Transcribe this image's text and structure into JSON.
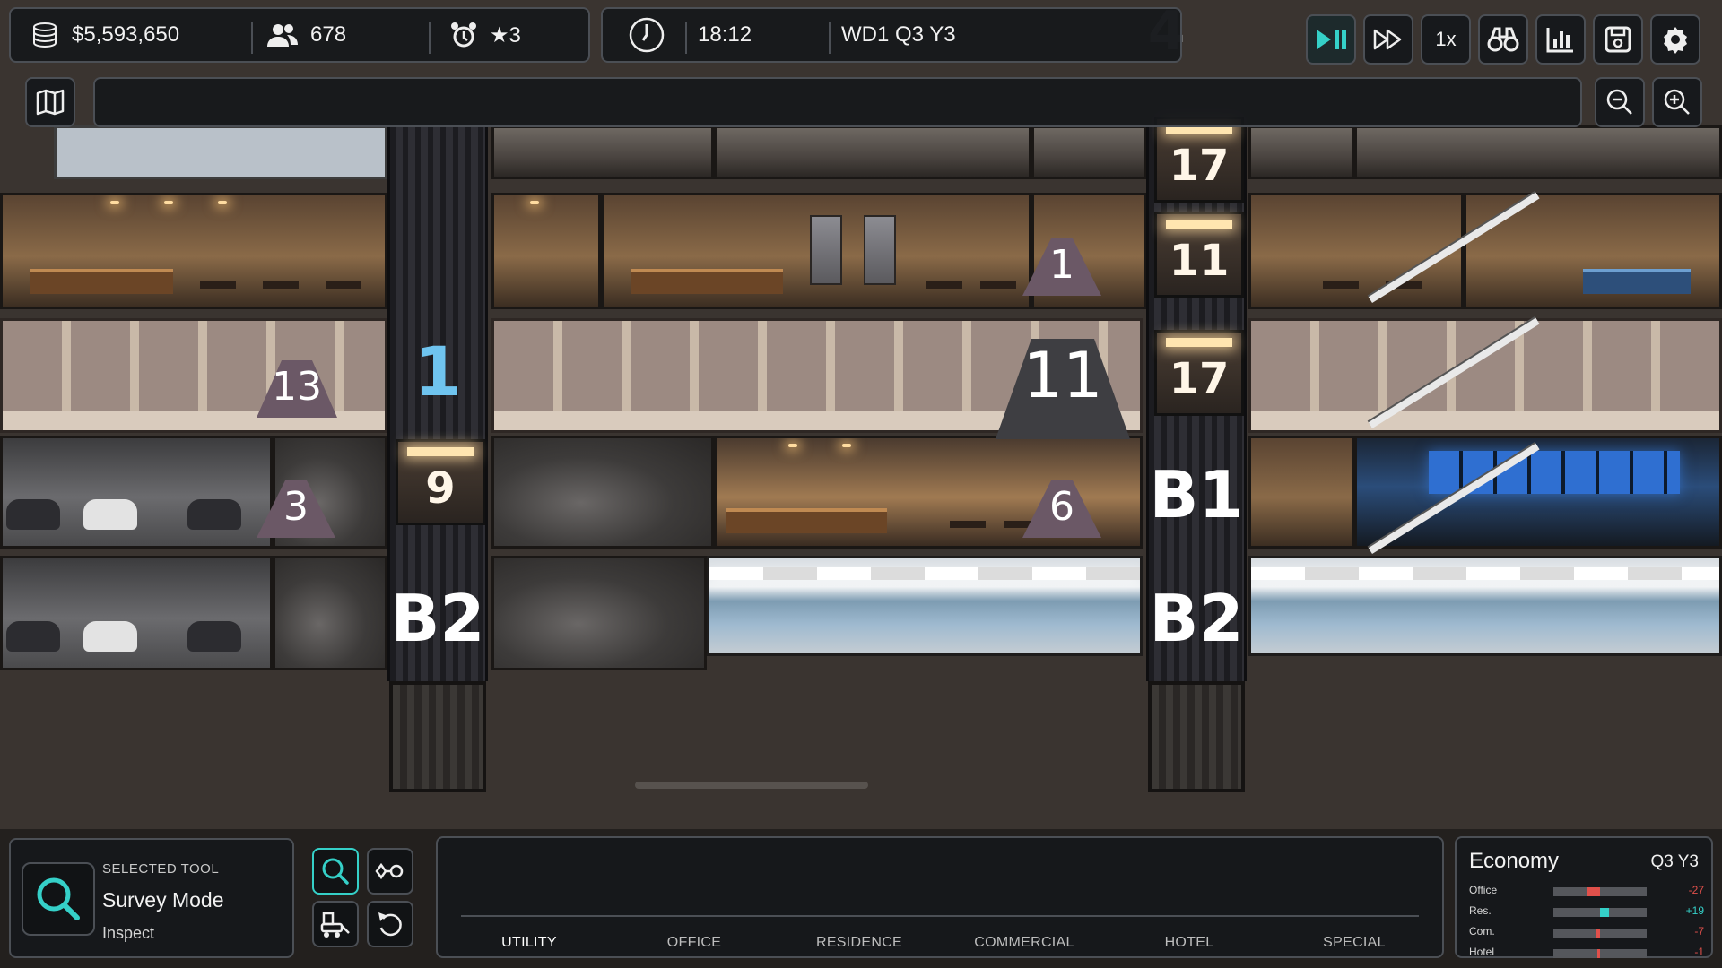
{
  "hud": {
    "money": "$5,593,650",
    "population": "678",
    "rating": "★3",
    "time": "18:12",
    "date": "WD1 Q3 Y3",
    "speed_label": "1x",
    "search_placeholder": ""
  },
  "scene": {
    "shafts": [
      {
        "labels": [
          "1",
          "B2"
        ],
        "cabs": [
          "9"
        ]
      },
      {
        "labels": [
          "B1",
          "B2"
        ],
        "cabs": [
          "17",
          "11",
          "17"
        ]
      }
    ],
    "queues": [
      "13",
      "3",
      "1",
      "11",
      "6"
    ],
    "background_floor_label": "4"
  },
  "tool": {
    "caption": "SELECTED TOOL",
    "name": "Survey Mode",
    "sub": "Inspect"
  },
  "build": {
    "tabs": [
      "UTILITY",
      "OFFICE",
      "RESIDENCE",
      "COMMERCIAL",
      "HOTEL",
      "SPECIAL"
    ],
    "active_tab": "UTILITY"
  },
  "economy": {
    "title": "Economy",
    "period": "Q3 Y3",
    "rows": [
      {
        "label": "Office",
        "value": "-27",
        "level": -0.27
      },
      {
        "label": "Res.",
        "value": "+19",
        "level": 0.19
      },
      {
        "label": "Com.",
        "value": "-7",
        "level": -0.07
      },
      {
        "label": "Hotel",
        "value": "-1",
        "level": -0.01
      }
    ]
  },
  "colors": {
    "accent": "#35d0c8",
    "positive": "#35d0c8",
    "negative": "#e0504b",
    "queue": "#6b5866"
  },
  "icons": [
    "coins-icon",
    "people-icon",
    "alarm-icon",
    "clock-icon",
    "play-pause-icon",
    "fast-forward-icon",
    "binoculars-icon",
    "chart-icon",
    "save-icon",
    "gear-icon",
    "map-icon",
    "zoom-out-icon",
    "zoom-in-icon",
    "search-icon",
    "settings-toggle-icon",
    "bulldozer-icon",
    "undo-icon"
  ]
}
